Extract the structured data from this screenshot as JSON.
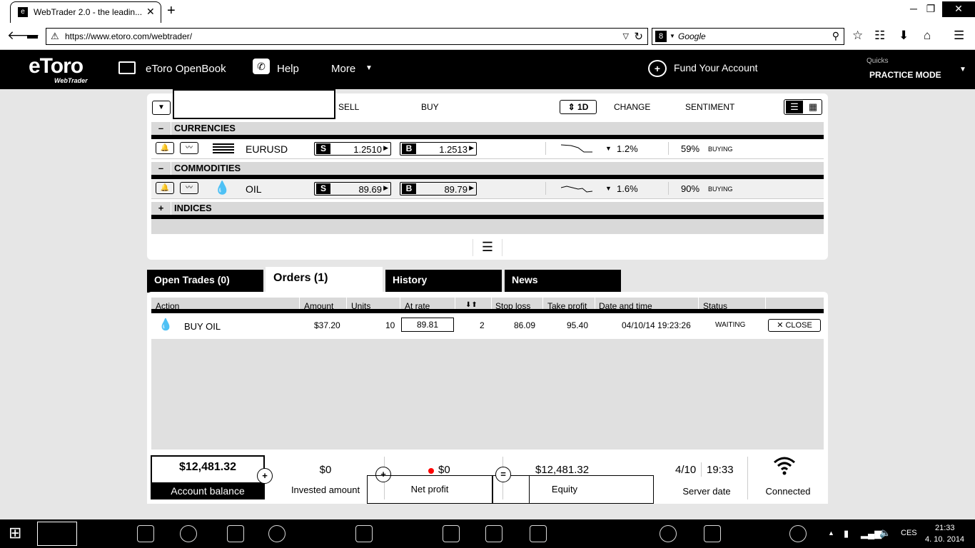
{
  "browser": {
    "tab_title": "WebTrader 2.0 - the leadin...",
    "tab_close": "✕",
    "new_tab": "+",
    "url": "https://www.etoro.com/webtrader/",
    "search_placeholder": "Google",
    "window_controls": [
      "─",
      "❐",
      "✕"
    ]
  },
  "header": {
    "logo": "eToro",
    "logo_sub": "WebTrader",
    "nav": [
      "eToro OpenBook",
      "Help",
      "More"
    ],
    "fund": "Fund Your Account",
    "user": "Quicks",
    "mode": "PRACTICE MODE"
  },
  "market": {
    "columns": {
      "sell": "SELL",
      "buy": "BUY",
      "period": "1D",
      "change": "CHANGE",
      "sentiment": "SENTIMENT"
    },
    "groups": [
      {
        "toggle": "–",
        "name": "CURRENCIES",
        "rows": [
          {
            "name": "EURUSD",
            "sell": "1.2510",
            "buy": "1.2513",
            "change": "1.2%",
            "sentiment": "59%",
            "sentiment_label": "BUYING"
          }
        ]
      },
      {
        "toggle": "–",
        "name": "COMMODITIES",
        "rows": [
          {
            "name": "OIL",
            "sell": "89.69",
            "buy": "89.79",
            "change": "1.6%",
            "sentiment": "90%",
            "sentiment_label": "BUYING"
          }
        ]
      },
      {
        "toggle": "+",
        "name": "INDICES",
        "rows": []
      }
    ],
    "sell_tag": "S",
    "buy_tag": "B"
  },
  "tabs": [
    "Open Trades (0)",
    "Orders (1)",
    "History",
    "News"
  ],
  "active_tab": "Orders (1)",
  "orders": {
    "headers": [
      "Action",
      "Amount",
      "Units",
      "At rate",
      "⬇⬆",
      "Stop loss",
      "Take profit",
      "Date and time",
      "Status"
    ],
    "rows": [
      {
        "action": "BUY OIL",
        "amount": "$37.20",
        "units": "10",
        "rate": "89.81",
        "leverage": "2",
        "stop_loss": "86.09",
        "take_profit": "95.40",
        "datetime": "04/10/14 19:23:26",
        "status": "WAITING",
        "close": "CLOSE"
      }
    ]
  },
  "footer": {
    "balance": "$12,481.32",
    "balance_label": "Account balance",
    "invested": "$0",
    "invested_label": "Invested amount",
    "profit": "$0",
    "profit_label": "Net profit",
    "equity": "$12,481.32",
    "equity_label": "Equity",
    "date": "4/10",
    "time": "19:33",
    "server_label": "Server date",
    "connected_label": "Connected",
    "plus": "+",
    "equals": "="
  },
  "taskbar": {
    "lang": "CES",
    "time": "21:33",
    "date": "4. 10. 2014"
  },
  "colors": {
    "accent": "#000000",
    "profit_dot": "#ff0000",
    "page_bg": "#e6e6e6"
  }
}
